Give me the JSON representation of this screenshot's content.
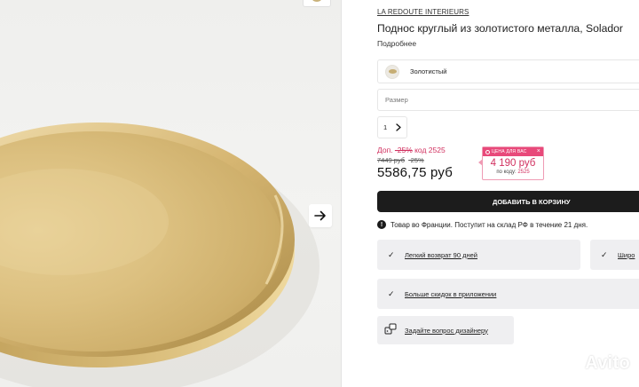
{
  "gallery": {
    "next_icon": "arrow-right-icon"
  },
  "product": {
    "brand": "LA REDOUTE INTERIEURS",
    "title": "Поднос круглый из золотистого металла, Solador",
    "more_link": "Подробнее"
  },
  "color_select": {
    "value": "Золотистый",
    "swatch_icon": "gold-tray-thumbnail"
  },
  "size_select": {
    "placeholder": "Размер"
  },
  "quantity": {
    "value": "1",
    "icon": "chevron-right-icon"
  },
  "pricing": {
    "promo_prefix": "Доп. ",
    "promo_percent": "-25%",
    "promo_code_text": " код 2525",
    "old_price": "7449 руб",
    "old_discount": "-25%",
    "current_price": "5586,75 руб",
    "accent_color": "#e8497a"
  },
  "deal_badge": {
    "header": "ЦЕНА ДЛЯ ВАС",
    "close": "×",
    "price": "4 190 руб",
    "code_label": "по коду: ",
    "code": "2525"
  },
  "cart_button": {
    "label": "ДОБАВИТЬ В КОРЗИНУ"
  },
  "delivery": {
    "icon": "exclamation-icon",
    "text": "Товар во Франции. Поступит на склад РФ в течение 21 дня."
  },
  "perks": [
    {
      "icon": "check-icon",
      "label": "Легкий возврат 90 дней"
    },
    {
      "icon": "check-icon",
      "label": "Широ"
    },
    {
      "icon": "check-icon",
      "label": "Больше скидок в приложении"
    },
    {
      "icon": "chat-icon",
      "label": "Задайте вопрос дизайнеру"
    }
  ],
  "watermark": {
    "text": "Avito"
  }
}
